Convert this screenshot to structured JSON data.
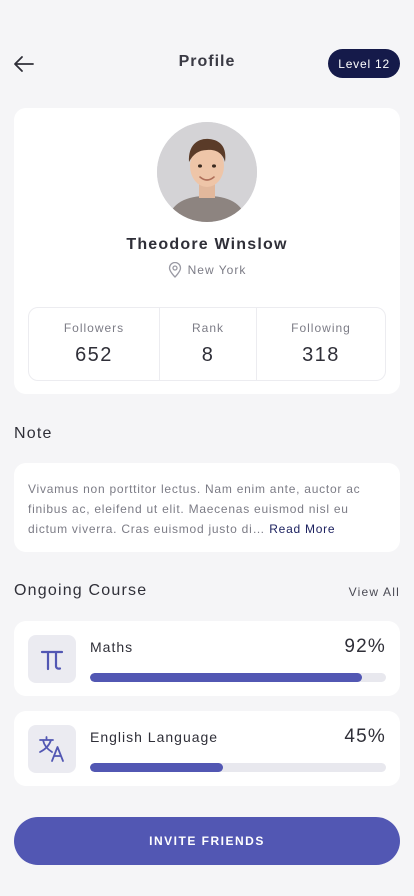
{
  "header": {
    "title": "Profile",
    "back_icon": "arrow-left-icon",
    "level_badge": "Level 12"
  },
  "profile": {
    "name": "Theodore Winslow",
    "location": "New York",
    "location_icon": "map-pin-icon",
    "stats": [
      {
        "label": "Followers",
        "value": "652"
      },
      {
        "label": "Rank",
        "value": "8"
      },
      {
        "label": "Following",
        "value": "318"
      }
    ]
  },
  "note": {
    "title": "Note",
    "text": "Vivamus non porttitor lectus. Nam enim ante, auctor ac finibus ac, eleifend ut elit. Maecenas euismod nisl eu dictum viverra. Cras euismod justo di…",
    "read_more": "Read More"
  },
  "courses": {
    "title": "Ongoing Course",
    "view_all": "View All",
    "items": [
      {
        "name": "Maths",
        "percent_label": "92%",
        "progress": 0.92,
        "icon": "pi-icon"
      },
      {
        "name": "English Language",
        "percent_label": "45%",
        "progress": 0.45,
        "icon": "translate-icon"
      }
    ]
  },
  "invite_button": "INVITE FRIENDS",
  "colors": {
    "accent": "#5257b3",
    "badge": "#151a4a",
    "background": "#f5f5f7",
    "card": "#ffffff"
  }
}
